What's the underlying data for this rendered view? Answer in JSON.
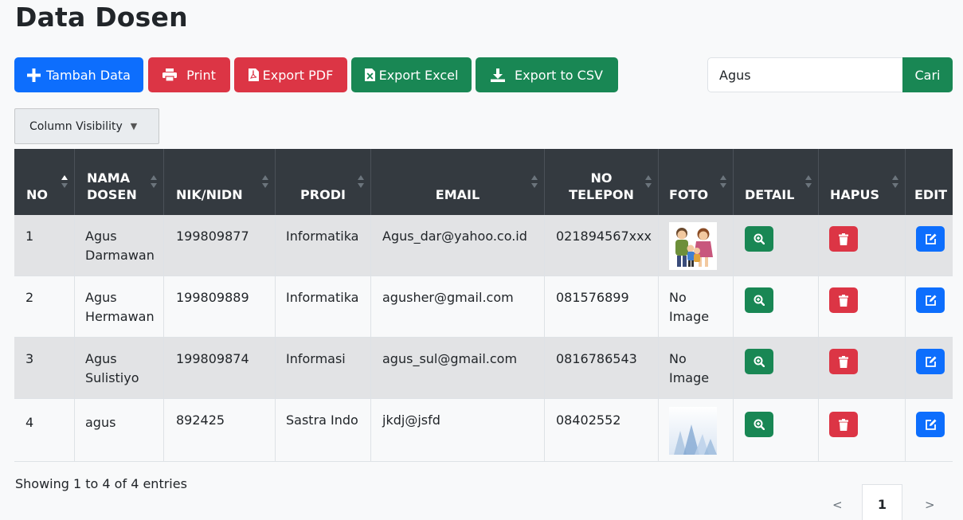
{
  "page": {
    "title": "Data Dosen"
  },
  "toolbar": {
    "add_label": "Tambah Data",
    "print_label": "Print",
    "pdf_label": "Export PDF",
    "excel_label": "Export Excel",
    "csv_label": "Export to CSV"
  },
  "search": {
    "value": "Agus",
    "button_label": "Cari"
  },
  "colvis": {
    "label": "Column Visibility"
  },
  "table": {
    "headers": {
      "no": "NO",
      "nama_1": "NAMA",
      "nama_2": "DOSEN",
      "nik": "NIK/NIDN",
      "prodi": "PRODI",
      "email": "EMAIL",
      "telp_1": "NO",
      "telp_2": "TELEPON",
      "foto": "FOTO",
      "detail": "DETAIL",
      "hapus": "HAPUS",
      "edit": "EDIT"
    },
    "rows": [
      {
        "no": "1",
        "nama_1": "Agus",
        "nama_2": "Darmawan",
        "nik": "199809877",
        "prodi": "Informatika",
        "email": "Agus_dar@yahoo.co.id",
        "telp": "021894567xxx",
        "foto_1": "",
        "foto_2": "",
        "foto_kind": "family-image"
      },
      {
        "no": "2",
        "nama_1": "Agus",
        "nama_2": "Hermawan",
        "nik": "199809889",
        "prodi": "Informatika",
        "email": "agusher@gmail.com",
        "telp": "081576899",
        "foto_1": "No",
        "foto_2": "Image",
        "foto_kind": "text"
      },
      {
        "no": "3",
        "nama_1": "Agus",
        "nama_2": "Sulistiyo",
        "nik": "199809874",
        "prodi": "Informasi",
        "email": "agus_sul@gmail.com",
        "telp": "0816786543",
        "foto_1": "No",
        "foto_2": "Image",
        "foto_kind": "text"
      },
      {
        "no": "4",
        "nama_1": "agus",
        "nama_2": "",
        "nik": "892425",
        "prodi": "Sastra Indo",
        "email": "jkdj@jsfd",
        "telp": "08402552",
        "foto_1": "",
        "foto_2": "",
        "foto_kind": "abstract-image"
      }
    ]
  },
  "footer": {
    "info": "Showing 1 to 4 of 4 entries",
    "prev": "<",
    "current_page": "1",
    "next": ">"
  },
  "colors": {
    "primary": "#0d6efd",
    "danger": "#dc3545",
    "success": "#198754",
    "table_head": "#343a40"
  }
}
